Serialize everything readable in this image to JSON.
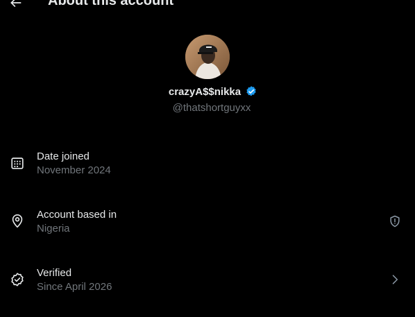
{
  "header": {
    "title": "About this account",
    "back_icon": "arrow-left-icon"
  },
  "profile": {
    "display_name": "crazyA$$nikka",
    "handle": "@thatshortguyxx",
    "verified": true,
    "badge_color": "#1d9bf0"
  },
  "details": {
    "date_joined": {
      "label": "Date joined",
      "value": "November 2024",
      "icon": "calendar-icon"
    },
    "account_based": {
      "label": "Account based in",
      "value": "Nigeria",
      "icon": "location-pin-icon",
      "trailing_icon": "shield-alert-icon"
    },
    "verified": {
      "label": "Verified",
      "value": "Since April 2026",
      "icon": "verified-check-icon",
      "trailing_icon": "chevron-right-icon"
    }
  },
  "colors": {
    "background": "#000000",
    "primary_text": "#e7e9ea",
    "secondary_text": "#71767b",
    "accent": "#1d9bf0"
  }
}
